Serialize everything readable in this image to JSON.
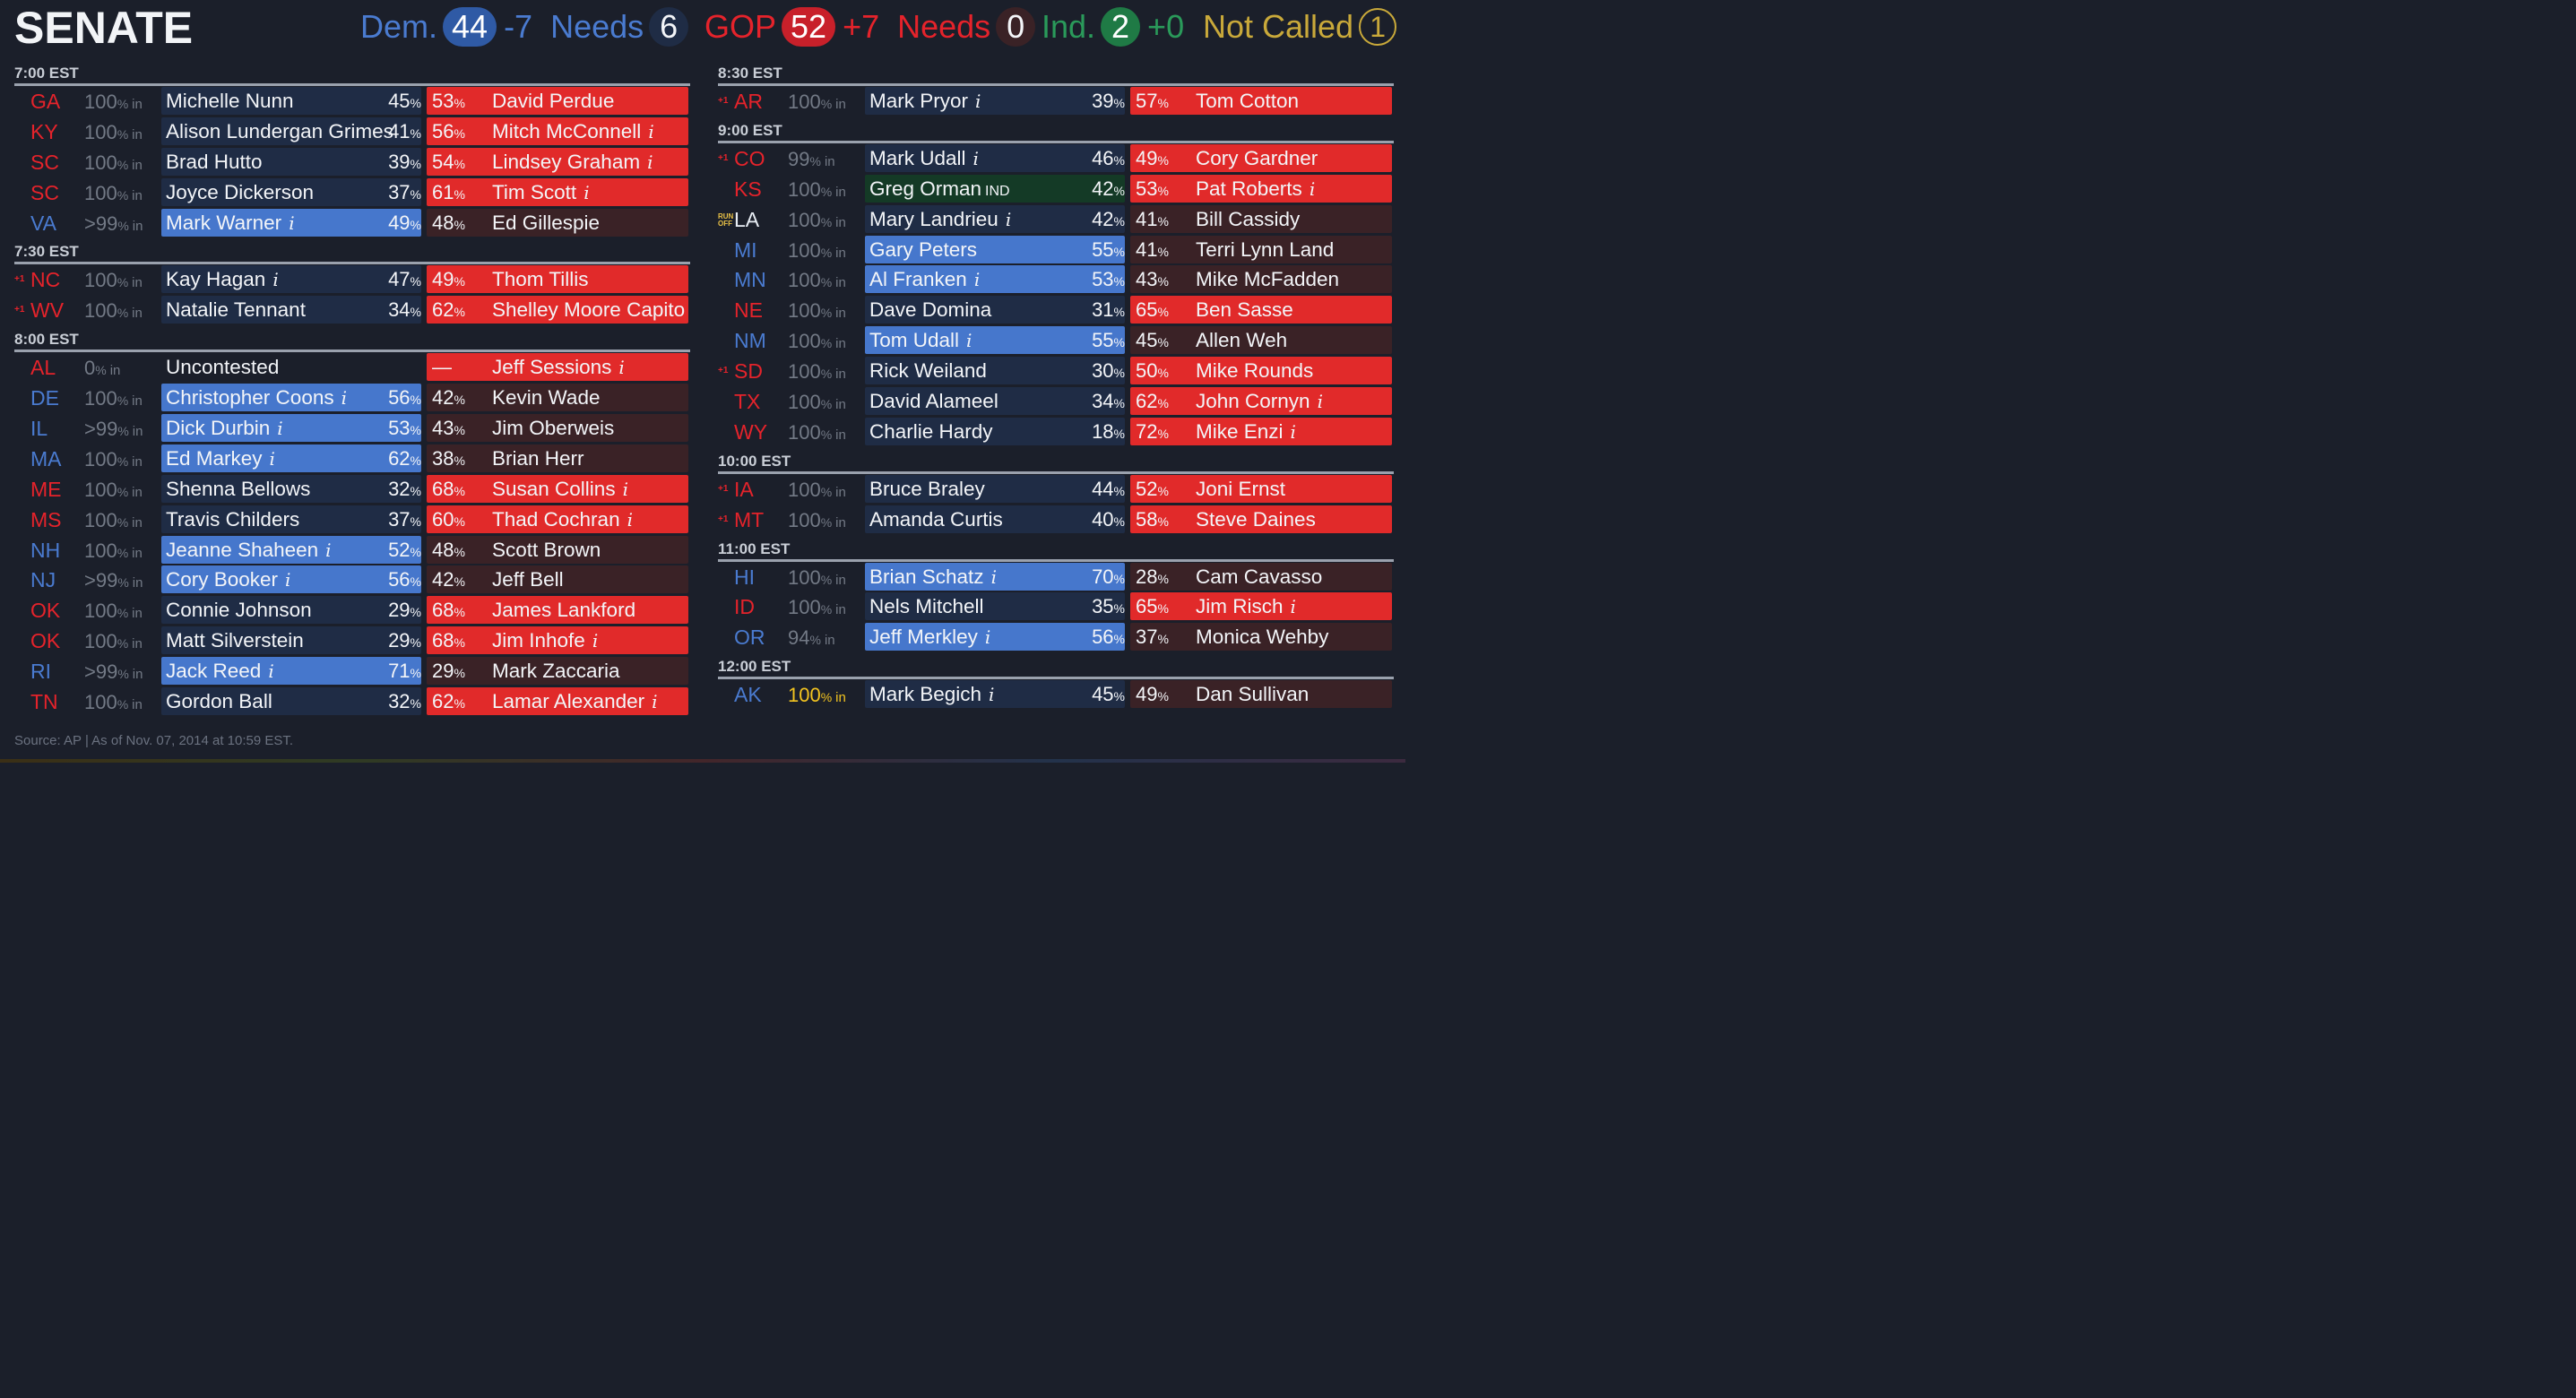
{
  "header": {
    "title": "SENATE",
    "dem": {
      "label": "Dem.",
      "count": "44",
      "change": "-7",
      "needs_label": "Needs",
      "needs": "6"
    },
    "gop": {
      "label": "GOP",
      "count": "52",
      "change": "+7",
      "needs_label": "Needs",
      "needs": "0"
    },
    "ind": {
      "label": "Ind.",
      "count": "2",
      "change": "+0"
    },
    "not_called": {
      "label": "Not Called",
      "count": "1"
    }
  },
  "colors": {
    "dem_winner": "#4677cc",
    "dem_row": "#1f2c45",
    "gop_winner": "#e12a2a",
    "gop_row": "#3a2226",
    "ind_row": "#143a26",
    "dem_text": "#4a7bd0",
    "gop_text": "#e5232b",
    "ind_text": "#2a9a5a",
    "not_called": "#c9a93a"
  },
  "pct_suffix": "%",
  "in_suffix": "in",
  "info_icon": "i",
  "ind_tag": "IND",
  "flag_gain": "+1",
  "flag_runoff": "RUN OFF",
  "columns": [
    {
      "sections": [
        {
          "time": "7:00 EST",
          "races": [
            {
              "state": "GA",
              "state_party": "r",
              "reporting": "100",
              "dem": "Michelle Nunn",
              "dem_pct": "45",
              "gop": "David Perdue",
              "gop_pct": "53",
              "winner": "r",
              "dem_info": false,
              "gop_info": false,
              "flag": ""
            },
            {
              "state": "KY",
              "state_party": "r",
              "reporting": "100",
              "dem": "Alison Lundergan Grimes",
              "dem_pct": "41",
              "gop": "Mitch McConnell",
              "gop_pct": "56",
              "winner": "r",
              "dem_info": false,
              "gop_info": true,
              "flag": ""
            },
            {
              "state": "SC",
              "state_party": "r",
              "reporting": "100",
              "dem": "Brad Hutto",
              "dem_pct": "39",
              "gop": "Lindsey Graham",
              "gop_pct": "54",
              "winner": "r",
              "dem_info": false,
              "gop_info": true,
              "flag": ""
            },
            {
              "state": "SC",
              "state_party": "r",
              "reporting": "100",
              "dem": "Joyce Dickerson",
              "dem_pct": "37",
              "gop": "Tim Scott",
              "gop_pct": "61",
              "winner": "r",
              "dem_info": false,
              "gop_info": true,
              "flag": ""
            },
            {
              "state": "VA",
              "state_party": "d",
              "reporting": ">99",
              "dem": "Mark Warner",
              "dem_pct": "49",
              "gop": "Ed Gillespie",
              "gop_pct": "48",
              "winner": "d",
              "dem_info": true,
              "gop_info": false,
              "flag": ""
            }
          ]
        },
        {
          "time": "7:30 EST",
          "races": [
            {
              "state": "NC",
              "state_party": "r",
              "reporting": "100",
              "dem": "Kay Hagan",
              "dem_pct": "47",
              "gop": "Thom Tillis",
              "gop_pct": "49",
              "winner": "r",
              "dem_info": true,
              "gop_info": false,
              "flag": "gain"
            },
            {
              "state": "WV",
              "state_party": "r",
              "reporting": "100",
              "dem": "Natalie Tennant",
              "dem_pct": "34",
              "gop": "Shelley Moore Capito",
              "gop_pct": "62",
              "winner": "r",
              "dem_info": false,
              "gop_info": false,
              "flag": "gain"
            }
          ]
        },
        {
          "time": "8:00 EST",
          "races": [
            {
              "state": "AL",
              "state_party": "r",
              "reporting": "0",
              "dem": "Uncontested",
              "dem_pct": "",
              "gop": "Jeff Sessions",
              "gop_pct": "—",
              "winner": "r",
              "dem_info": false,
              "gop_info": true,
              "flag": "",
              "dem_style": "nowin"
            },
            {
              "state": "DE",
              "state_party": "d",
              "reporting": "100",
              "dem": "Christopher Coons",
              "dem_pct": "56",
              "gop": "Kevin Wade",
              "gop_pct": "42",
              "winner": "d",
              "dem_info": true,
              "gop_info": false,
              "flag": ""
            },
            {
              "state": "IL",
              "state_party": "d",
              "reporting": ">99",
              "dem": "Dick Durbin",
              "dem_pct": "53",
              "gop": "Jim Oberweis",
              "gop_pct": "43",
              "winner": "d",
              "dem_info": true,
              "gop_info": false,
              "flag": ""
            },
            {
              "state": "MA",
              "state_party": "d",
              "reporting": "100",
              "dem": "Ed Markey",
              "dem_pct": "62",
              "gop": "Brian Herr",
              "gop_pct": "38",
              "winner": "d",
              "dem_info": true,
              "gop_info": false,
              "flag": ""
            },
            {
              "state": "ME",
              "state_party": "r",
              "reporting": "100",
              "dem": "Shenna Bellows",
              "dem_pct": "32",
              "gop": "Susan Collins",
              "gop_pct": "68",
              "winner": "r",
              "dem_info": false,
              "gop_info": true,
              "flag": ""
            },
            {
              "state": "MS",
              "state_party": "r",
              "reporting": "100",
              "dem": "Travis Childers",
              "dem_pct": "37",
              "gop": "Thad Cochran",
              "gop_pct": "60",
              "winner": "r",
              "dem_info": false,
              "gop_info": true,
              "flag": ""
            },
            {
              "state": "NH",
              "state_party": "d",
              "reporting": "100",
              "dem": "Jeanne Shaheen",
              "dem_pct": "52",
              "gop": "Scott Brown",
              "gop_pct": "48",
              "winner": "d",
              "dem_info": true,
              "gop_info": false,
              "flag": ""
            },
            {
              "state": "NJ",
              "state_party": "d",
              "reporting": ">99",
              "dem": "Cory Booker",
              "dem_pct": "56",
              "gop": "Jeff Bell",
              "gop_pct": "42",
              "winner": "d",
              "dem_info": true,
              "gop_info": false,
              "flag": ""
            },
            {
              "state": "OK",
              "state_party": "r",
              "reporting": "100",
              "dem": "Connie Johnson",
              "dem_pct": "29",
              "gop": "James Lankford",
              "gop_pct": "68",
              "winner": "r",
              "dem_info": false,
              "gop_info": false,
              "flag": ""
            },
            {
              "state": "OK",
              "state_party": "r",
              "reporting": "100",
              "dem": "Matt Silverstein",
              "dem_pct": "29",
              "gop": "Jim Inhofe",
              "gop_pct": "68",
              "winner": "r",
              "dem_info": false,
              "gop_info": true,
              "flag": ""
            },
            {
              "state": "RI",
              "state_party": "d",
              "reporting": ">99",
              "dem": "Jack Reed",
              "dem_pct": "71",
              "gop": "Mark Zaccaria",
              "gop_pct": "29",
              "winner": "d",
              "dem_info": true,
              "gop_info": false,
              "flag": ""
            },
            {
              "state": "TN",
              "state_party": "r",
              "reporting": "100",
              "dem": "Gordon Ball",
              "dem_pct": "32",
              "gop": "Lamar Alexander",
              "gop_pct": "62",
              "winner": "r",
              "dem_info": false,
              "gop_info": true,
              "flag": ""
            }
          ]
        }
      ]
    },
    {
      "sections": [
        {
          "time": "8:30 EST",
          "races": [
            {
              "state": "AR",
              "state_party": "r",
              "reporting": "100",
              "dem": "Mark Pryor",
              "dem_pct": "39",
              "gop": "Tom Cotton",
              "gop_pct": "57",
              "winner": "r",
              "dem_info": true,
              "gop_info": false,
              "flag": "gain"
            }
          ]
        },
        {
          "time": "9:00 EST",
          "races": [
            {
              "state": "CO",
              "state_party": "r",
              "reporting": "99",
              "dem": "Mark Udall",
              "dem_pct": "46",
              "gop": "Cory Gardner",
              "gop_pct": "49",
              "winner": "r",
              "dem_info": true,
              "gop_info": false,
              "flag": "gain"
            },
            {
              "state": "KS",
              "state_party": "r",
              "reporting": "100",
              "dem": "Greg Orman",
              "dem_pct": "42",
              "gop": "Pat Roberts",
              "gop_pct": "53",
              "winner": "r",
              "dem_info": false,
              "gop_info": true,
              "flag": "",
              "ind": true
            },
            {
              "state": "LA",
              "state_party": "n",
              "reporting": "100",
              "dem": "Mary Landrieu",
              "dem_pct": "42",
              "gop": "Bill Cassidy",
              "gop_pct": "41",
              "winner": "none",
              "dem_info": true,
              "gop_info": false,
              "flag": "runoff"
            },
            {
              "state": "MI",
              "state_party": "d",
              "reporting": "100",
              "dem": "Gary Peters",
              "dem_pct": "55",
              "gop": "Terri Lynn Land",
              "gop_pct": "41",
              "winner": "d",
              "dem_info": false,
              "gop_info": false,
              "flag": ""
            },
            {
              "state": "MN",
              "state_party": "d",
              "reporting": "100",
              "dem": "Al Franken",
              "dem_pct": "53",
              "gop": "Mike McFadden",
              "gop_pct": "43",
              "winner": "d",
              "dem_info": true,
              "gop_info": false,
              "flag": ""
            },
            {
              "state": "NE",
              "state_party": "r",
              "reporting": "100",
              "dem": "Dave Domina",
              "dem_pct": "31",
              "gop": "Ben Sasse",
              "gop_pct": "65",
              "winner": "r",
              "dem_info": false,
              "gop_info": false,
              "flag": ""
            },
            {
              "state": "NM",
              "state_party": "d",
              "reporting": "100",
              "dem": "Tom Udall",
              "dem_pct": "55",
              "gop": "Allen Weh",
              "gop_pct": "45",
              "winner": "d",
              "dem_info": true,
              "gop_info": false,
              "flag": ""
            },
            {
              "state": "SD",
              "state_party": "r",
              "reporting": "100",
              "dem": "Rick Weiland",
              "dem_pct": "30",
              "gop": "Mike Rounds",
              "gop_pct": "50",
              "winner": "r",
              "dem_info": false,
              "gop_info": false,
              "flag": "gain"
            },
            {
              "state": "TX",
              "state_party": "r",
              "reporting": "100",
              "dem": "David Alameel",
              "dem_pct": "34",
              "gop": "John Cornyn",
              "gop_pct": "62",
              "winner": "r",
              "dem_info": false,
              "gop_info": true,
              "flag": ""
            },
            {
              "state": "WY",
              "state_party": "r",
              "reporting": "100",
              "dem": "Charlie Hardy",
              "dem_pct": "18",
              "gop": "Mike Enzi",
              "gop_pct": "72",
              "winner": "r",
              "dem_info": false,
              "gop_info": true,
              "flag": ""
            }
          ]
        },
        {
          "time": "10:00 EST",
          "races": [
            {
              "state": "IA",
              "state_party": "r",
              "reporting": "100",
              "dem": "Bruce Braley",
              "dem_pct": "44",
              "gop": "Joni Ernst",
              "gop_pct": "52",
              "winner": "r",
              "dem_info": false,
              "gop_info": false,
              "flag": "gain"
            },
            {
              "state": "MT",
              "state_party": "r",
              "reporting": "100",
              "dem": "Amanda Curtis",
              "dem_pct": "40",
              "gop": "Steve Daines",
              "gop_pct": "58",
              "winner": "r",
              "dem_info": false,
              "gop_info": false,
              "flag": "gain"
            }
          ]
        },
        {
          "time": "11:00 EST",
          "races": [
            {
              "state": "HI",
              "state_party": "d",
              "reporting": "100",
              "dem": "Brian Schatz",
              "dem_pct": "70",
              "gop": "Cam Cavasso",
              "gop_pct": "28",
              "winner": "d",
              "dem_info": true,
              "gop_info": false,
              "flag": ""
            },
            {
              "state": "ID",
              "state_party": "r",
              "reporting": "100",
              "dem": "Nels Mitchell",
              "dem_pct": "35",
              "gop": "Jim Risch",
              "gop_pct": "65",
              "winner": "r",
              "dem_info": false,
              "gop_info": true,
              "flag": ""
            },
            {
              "state": "OR",
              "state_party": "d",
              "reporting": "94",
              "dem": "Jeff Merkley",
              "dem_pct": "56",
              "gop": "Monica Wehby",
              "gop_pct": "37",
              "winner": "d",
              "dem_info": true,
              "gop_info": false,
              "flag": ""
            }
          ]
        },
        {
          "time": "12:00 EST",
          "races": [
            {
              "state": "AK",
              "state_party": "d",
              "reporting": "100",
              "dem": "Mark Begich",
              "dem_pct": "45",
              "gop": "Dan Sullivan",
              "gop_pct": "49",
              "winner": "none",
              "dem_info": true,
              "gop_info": false,
              "flag": "",
              "reporting_highlight": true
            }
          ]
        }
      ]
    }
  ],
  "footer": "Source: AP  |  As of Nov. 07, 2014 at 10:59 EST."
}
